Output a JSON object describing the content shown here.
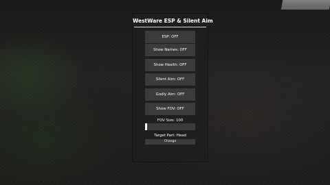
{
  "panel": {
    "title": "WestWare ESP & Silent Aim",
    "buttons": [
      {
        "label": "ESP: OFF"
      },
      {
        "label": "Show Names: OFF"
      },
      {
        "label": "Show Health: OFF"
      },
      {
        "label": "Silent Aim: OFF"
      },
      {
        "label": "Godly Aim: OFF"
      },
      {
        "label": "Show FOV: OFF"
      }
    ],
    "fov_label": "FOV Size: 100",
    "fov_slider_fraction": 0.04,
    "target_label": "Target Part: Head",
    "change_label": "Change"
  }
}
